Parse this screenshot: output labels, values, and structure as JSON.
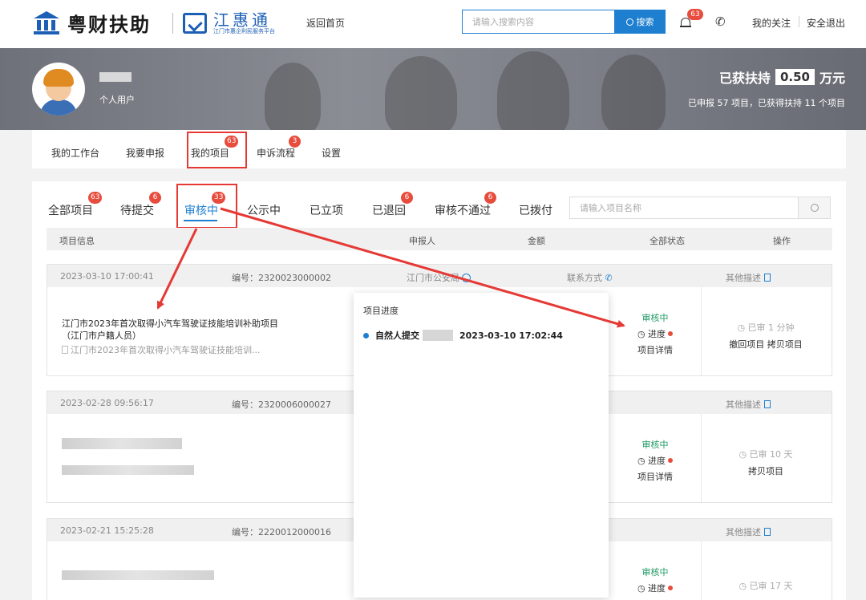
{
  "header": {
    "brand1": "粤财扶助",
    "brand2_title": "江惠通",
    "brand2_sub": "江门市惠企利民服务平台",
    "back_home": "返回首页",
    "search_placeholder": "请输入搜索内容",
    "search_button": "搜索",
    "notification_count": "63",
    "my_follow": "我的关注",
    "logout": "安全退出"
  },
  "profile": {
    "user_type": "个人用户",
    "support_label": "已获扶持",
    "support_amount": "0.50",
    "support_unit": "万元",
    "support_summary": "已申报 57 项目，已获得扶持 11 个项目"
  },
  "nav": {
    "items": [
      {
        "label": "我的工作台",
        "badge": ""
      },
      {
        "label": "我要申报",
        "badge": ""
      },
      {
        "label": "我的项目",
        "badge": "63"
      },
      {
        "label": "申诉流程",
        "badge": "3"
      },
      {
        "label": "设置",
        "badge": ""
      }
    ]
  },
  "tabs": [
    {
      "label": "全部项目",
      "badge": "63"
    },
    {
      "label": "待提交",
      "badge": "6"
    },
    {
      "label": "审核中",
      "badge": "33"
    },
    {
      "label": "公示中",
      "badge": ""
    },
    {
      "label": "已立项",
      "badge": ""
    },
    {
      "label": "已退回",
      "badge": "6"
    },
    {
      "label": "审核不通过",
      "badge": "6"
    },
    {
      "label": "已拨付",
      "badge": ""
    }
  ],
  "project_search_placeholder": "请输入项目名称",
  "table_headers": {
    "info": "项目信息",
    "applicant": "申报人",
    "amount": "金额",
    "status": "全部状态",
    "ops": "操作"
  },
  "projects": [
    {
      "date": "2023-03-10 17:00:41",
      "code": "编号：2320023000002",
      "dept": "江门市公安局",
      "contact": "联系方式",
      "other": "其他描述",
      "title": "江门市2023年首次取得小汽车驾驶证技能培训补助项目（江门市户籍人员）",
      "subtitle": "江门市2023年首次取得小汽车驾驶证技能培训...",
      "status": "审核中",
      "progress": "进度",
      "detail": "项目详情",
      "time": "已审 1 分钟",
      "actions": "撤回项目  拷贝项目"
    },
    {
      "date": "2023-02-28 09:56:17",
      "code": "编号：2320006000027",
      "other": "其他描述",
      "status": "审核中",
      "progress": "进度",
      "detail": "项目详情",
      "time": "已审 10 天",
      "actions": "拷贝项目"
    },
    {
      "date": "2023-02-21 15:25:28",
      "code": "编号：2220012000016",
      "other": "其他描述",
      "status": "审核中",
      "progress": "进度",
      "time": "已审 17 天"
    }
  ],
  "popup": {
    "title": "项目进度",
    "step_label": "自然人提交",
    "step_time": "2023-03-10 17:02:44"
  },
  "colors": {
    "accent": "#1e7fd0",
    "badge": "#e74c3c",
    "highlight": "#e53935",
    "status_green": "#1e9a63"
  }
}
